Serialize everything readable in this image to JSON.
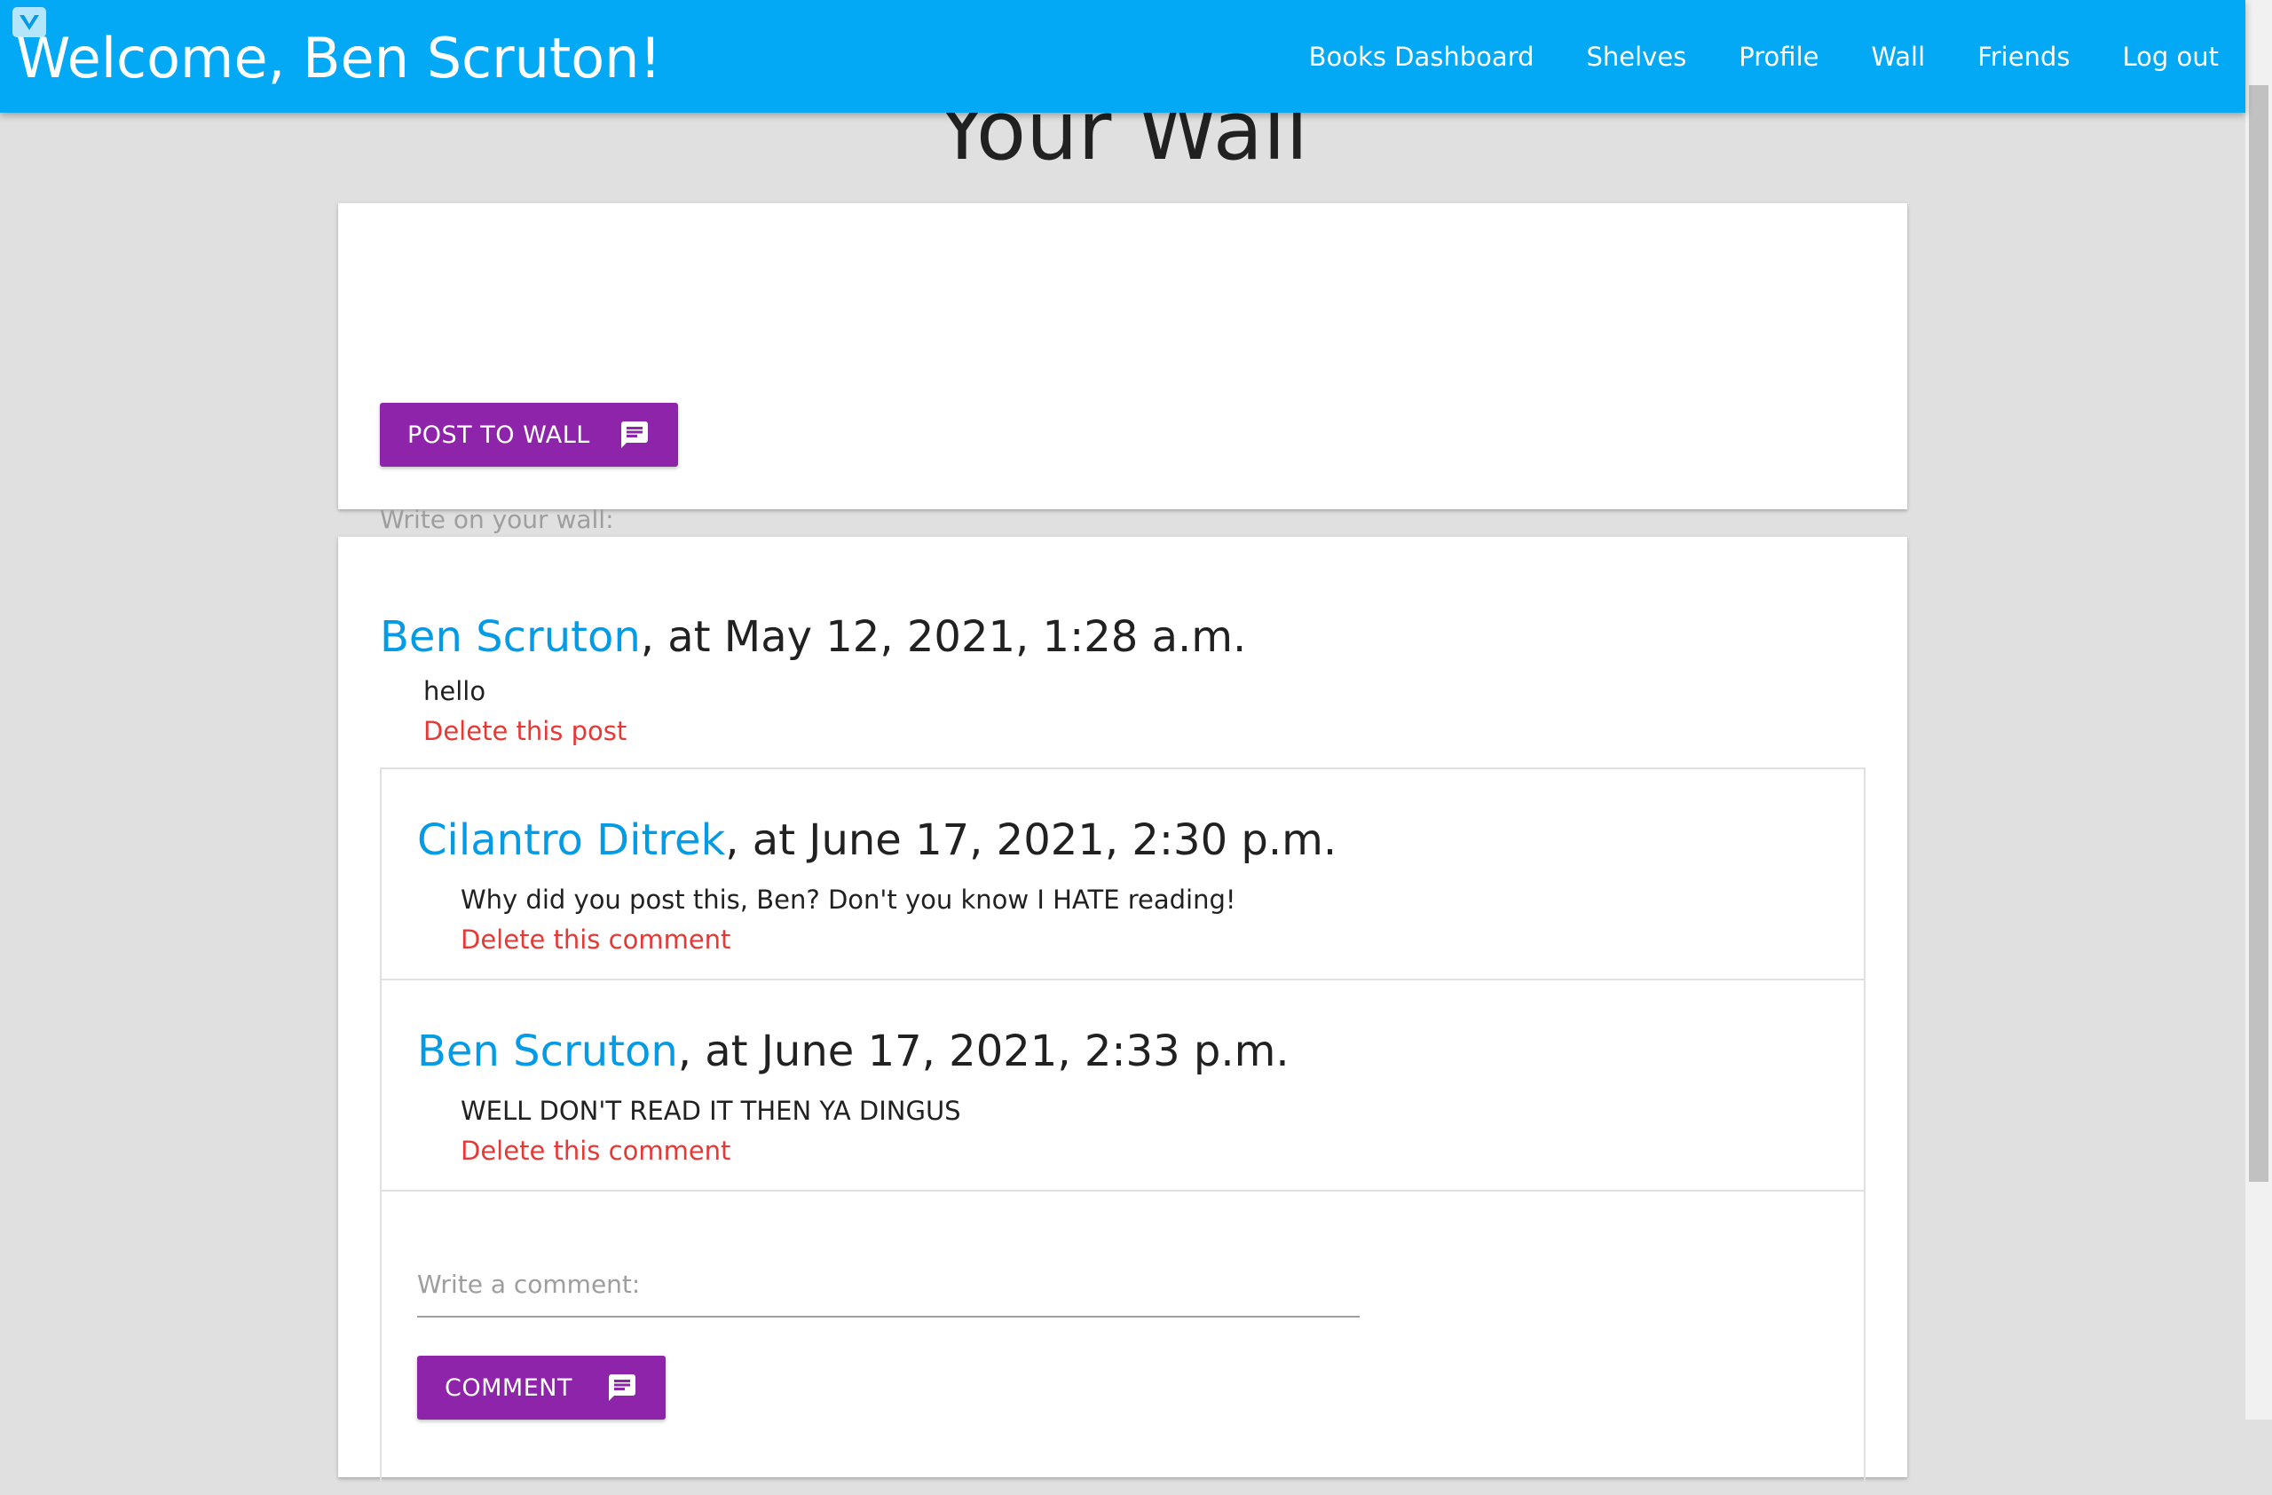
{
  "header": {
    "welcome": "Welcome, Ben Scruton!",
    "logo_icon": "vuetify-v-logo-icon",
    "bg_color": "#03a9f4",
    "nav": [
      {
        "label": "Books Dashboard"
      },
      {
        "label": "Shelves"
      },
      {
        "label": "Profile"
      },
      {
        "label": "Wall"
      },
      {
        "label": "Friends"
      },
      {
        "label": "Log out"
      }
    ]
  },
  "page": {
    "heading": "Your Wall"
  },
  "compose": {
    "placeholder": "Write on your wall:",
    "value": "",
    "button_label": "POST TO WALL",
    "button_icon": "message-icon",
    "button_color": "#8e24aa"
  },
  "post": {
    "author": "Ben Scruton",
    "timestamp": ", at May 12, 2021, 1:28 a.m.",
    "body": "hello",
    "delete_label": "Delete this post",
    "comments": [
      {
        "author": "Cilantro Ditrek",
        "timestamp": ", at June 17, 2021, 2:30 p.m.",
        "body": "Why did you post this, Ben? Don't you know I HATE reading!",
        "delete_label": "Delete this comment"
      },
      {
        "author": "Ben Scruton",
        "timestamp": ", at June 17, 2021, 2:33 p.m.",
        "body": "WELL DON'T READ IT THEN YA DINGUS",
        "delete_label": "Delete this comment"
      }
    ],
    "comment_form": {
      "placeholder": "Write a comment:",
      "value": "",
      "button_label": "COMMENT",
      "button_icon": "message-icon"
    }
  },
  "colors": {
    "link": "#039be5",
    "delete": "#e53935",
    "background": "#e0e0e0"
  }
}
